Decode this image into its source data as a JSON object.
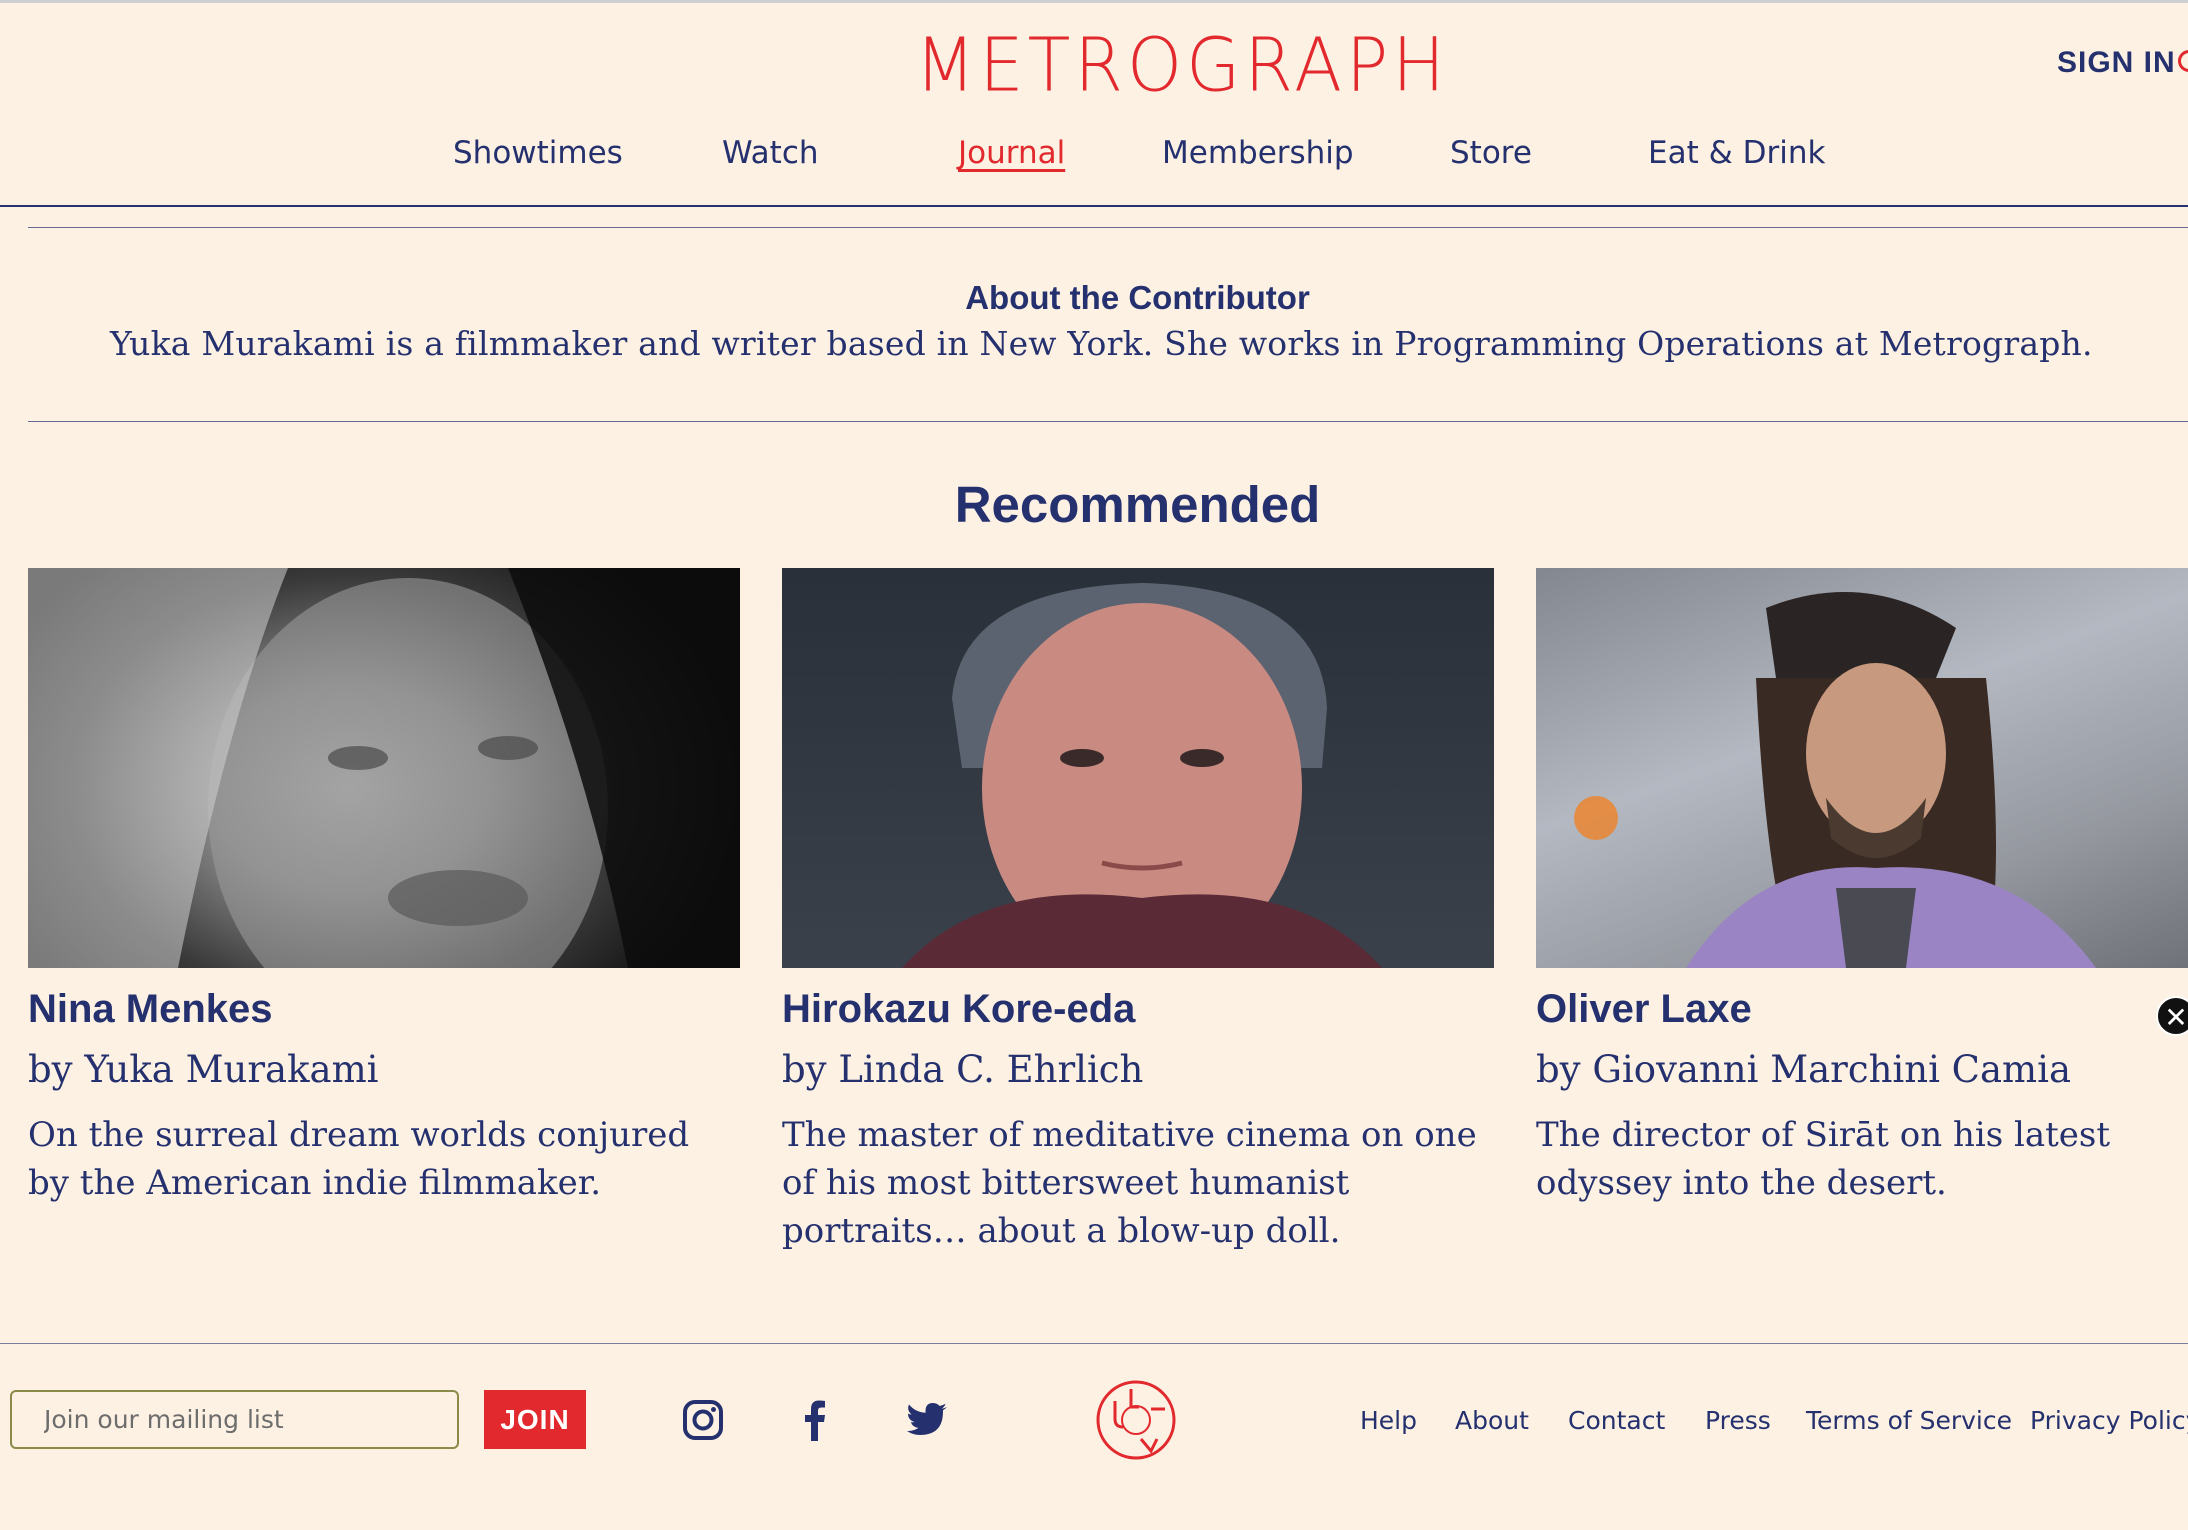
{
  "header": {
    "logo": "METROGRAPH",
    "sign_in": "SIGN IN"
  },
  "nav": [
    {
      "label": "Showtimes"
    },
    {
      "label": "Watch"
    },
    {
      "label": "Journal",
      "active": true
    },
    {
      "label": "Membership"
    },
    {
      "label": "Store"
    },
    {
      "label": "Eat & Drink"
    }
  ],
  "contributor": {
    "title": "About the Contributor",
    "text": "Yuka Murakami is a filmmaker and writer based in New York. She works in Programming Operations at Metrograph."
  },
  "recommended": {
    "title": "Recommended",
    "cards": [
      {
        "name": "Nina Menkes",
        "by": "by Yuka Murakami",
        "desc": "On the surreal dream worlds conjured by the American indie filmmaker."
      },
      {
        "name": "Hirokazu Kore-eda",
        "by": "by Linda C. Ehrlich",
        "desc": "The master of meditative cinema on one of his most bittersweet humanist portraits… about a blow-up doll."
      },
      {
        "name": "Oliver Laxe",
        "by": "by Giovanni Marchini Camia",
        "desc": "The director of Sirāt on his latest odyssey into the desert."
      }
    ]
  },
  "footer": {
    "mailing_placeholder": "Join our mailing list",
    "join": "JOIN",
    "links": [
      "Help",
      "About",
      "Contact",
      "Press",
      "Terms of Service",
      "Privacy Policy"
    ],
    "social": [
      "instagram-icon",
      "facebook-icon",
      "twitter-icon"
    ]
  },
  "colors": {
    "background": "#fdf1e3",
    "navy": "#25316f",
    "red": "#e2292e"
  }
}
